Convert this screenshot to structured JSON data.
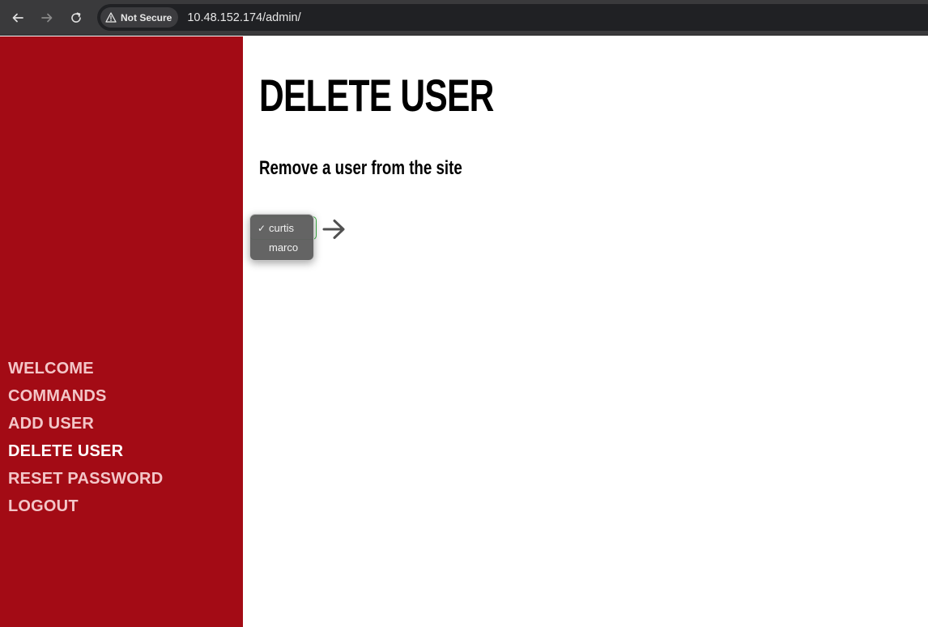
{
  "browser": {
    "security_label": "Not Secure",
    "url": "10.48.152.174/admin/"
  },
  "sidebar": {
    "items": [
      {
        "label": "WELCOME",
        "active": false
      },
      {
        "label": "COMMANDS",
        "active": false
      },
      {
        "label": "ADD USER",
        "active": false
      },
      {
        "label": "DELETE USER",
        "active": true
      },
      {
        "label": "RESET PASSWORD",
        "active": false
      },
      {
        "label": "LOGOUT",
        "active": false
      }
    ]
  },
  "main": {
    "title": "DELETE USER",
    "subtitle": "Remove a user from the site",
    "user_select": {
      "selected": "curtis",
      "options": [
        "curtis",
        "marco"
      ]
    },
    "submit_icon": "arrow-right-icon"
  },
  "colors": {
    "sidebar_bg": "#a30b15",
    "sidebar_text": "#f3c6c8",
    "sidebar_active_text": "#ffffff",
    "select_border": "#3cb043"
  }
}
